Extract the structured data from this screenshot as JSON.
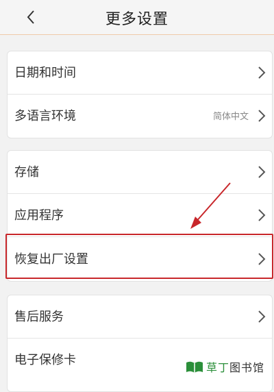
{
  "header": {
    "title": "更多设置",
    "back_icon": "chevron-left-icon"
  },
  "groups": [
    {
      "items": [
        {
          "label": "日期和时间",
          "value": ""
        },
        {
          "label": "多语言环境",
          "value": "简体中文"
        }
      ]
    },
    {
      "items": [
        {
          "label": "存储",
          "value": ""
        },
        {
          "label": "应用程序",
          "value": ""
        },
        {
          "label": "恢复出厂设置",
          "value": ""
        }
      ]
    },
    {
      "items": [
        {
          "label": "售后服务",
          "value": ""
        },
        {
          "label": "电子保修卡",
          "value": ""
        }
      ]
    }
  ],
  "annotation": {
    "highlight_color": "#c8262a",
    "arrow_color": "#c8262a"
  },
  "watermark": {
    "text_part1": "草丁",
    "text_part2": "图书馆",
    "accent_color": "#2b8f3a"
  }
}
